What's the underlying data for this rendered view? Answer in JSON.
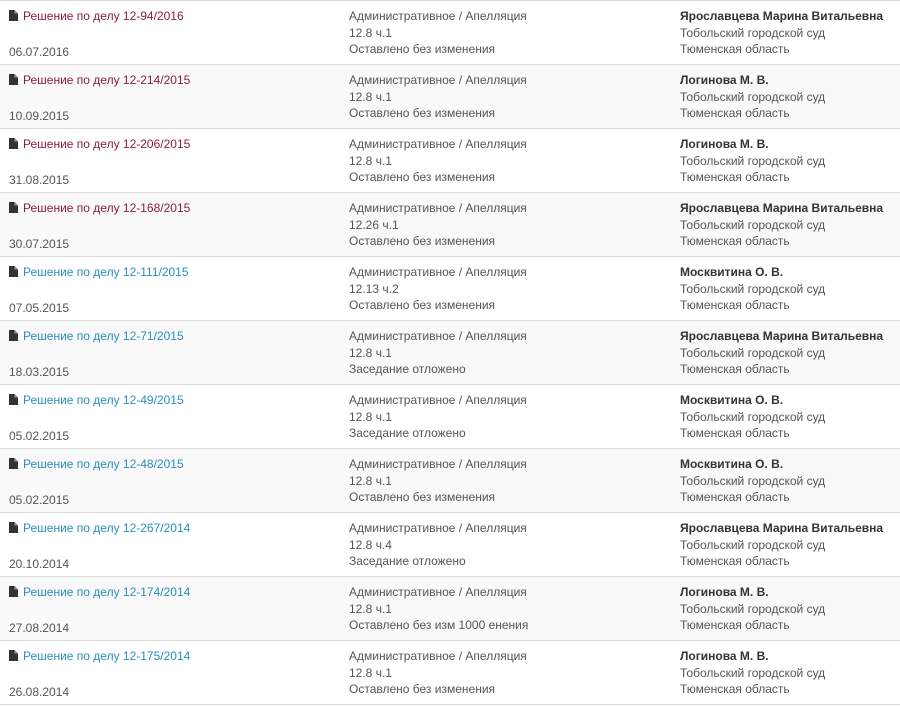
{
  "colors": {
    "visited_link": "#8b1a4a",
    "link": "#2a8dc0",
    "row_stripe": "#f9f9f9",
    "border": "#dddddd"
  },
  "icon": "document-icon",
  "rows": [
    {
      "title": "Решение по делу 12-94/2016",
      "date": "06.07.2016",
      "category": "Административное / Апелляция",
      "article": "12.8 ч.1",
      "result": "Оставлено без изменения",
      "judge": "Ярославцева Марина Витальевна",
      "court": "Тобольский городской суд",
      "region": "Тюменская область",
      "visited": true
    },
    {
      "title": "Решение по делу 12-214/2015",
      "date": "10.09.2015",
      "category": "Административное / Апелляция",
      "article": "12.8 ч.1",
      "result": "Оставлено без изменения",
      "judge": "Логинова М. В.",
      "court": "Тобольский городской суд",
      "region": "Тюменская область",
      "visited": true
    },
    {
      "title": "Решение по делу 12-206/2015",
      "date": "31.08.2015",
      "category": "Административное / Апелляция",
      "article": "12.8 ч.1",
      "result": "Оставлено без изменения",
      "judge": "Логинова М. В.",
      "court": "Тобольский городской суд",
      "region": "Тюменская область",
      "visited": true
    },
    {
      "title": "Решение по делу 12-168/2015",
      "date": "30.07.2015",
      "category": "Административное / Апелляция",
      "article": "12.26 ч.1",
      "result": "Оставлено без изменения",
      "judge": "Ярославцева Марина Витальевна",
      "court": "Тобольский городской суд",
      "region": "Тюменская область",
      "visited": true
    },
    {
      "title": "Решение по делу 12-111/2015",
      "date": "07.05.2015",
      "category": "Административное / Апелляция",
      "article": "12.13 ч.2",
      "result": "Оставлено без изменения",
      "judge": "Москвитина О. В.",
      "court": "Тобольский городской суд",
      "region": "Тюменская область",
      "visited": false
    },
    {
      "title": "Решение по делу 12-71/2015",
      "date": "18.03.2015",
      "category": "Административное / Апелляция",
      "article": "12.8 ч.1",
      "result": "Заседание отложено",
      "judge": "Ярославцева Марина Витальевна",
      "court": "Тобольский городской суд",
      "region": "Тюменская область",
      "visited": false
    },
    {
      "title": "Решение по делу 12-49/2015",
      "date": "05.02.2015",
      "category": "Административное / Апелляция",
      "article": "12.8 ч.1",
      "result": "Заседание отложено",
      "judge": "Москвитина О. В.",
      "court": "Тобольский городской суд",
      "region": "Тюменская область",
      "visited": false
    },
    {
      "title": "Решение по делу 12-48/2015",
      "date": "05.02.2015",
      "category": "Административное / Апелляция",
      "article": "12.8 ч.1",
      "result": "Оставлено без изменения",
      "judge": "Москвитина О. В.",
      "court": "Тобольский городской суд",
      "region": "Тюменская область",
      "visited": false
    },
    {
      "title": "Решение по делу 12-267/2014",
      "date": "20.10.2014",
      "category": "Административное / Апелляция",
      "article": "12.8 ч.4",
      "result": "Заседание отложено",
      "judge": "Ярославцева Марина Витальевна",
      "court": "Тобольский городской суд",
      "region": "Тюменская область",
      "visited": false
    },
    {
      "title": "Решение по делу 12-174/2014",
      "date": "27.08.2014",
      "category": "Административное / Апелляция",
      "article": "12.8 ч.1",
      "result": "Оставлено без изм 1000 енения",
      "judge": "Логинова М. В.",
      "court": "Тобольский городской суд",
      "region": "Тюменская область",
      "visited": false
    },
    {
      "title": "Решение по делу 12-175/2014",
      "date": "26.08.2014",
      "category": "Административное / Апелляция",
      "article": "12.8 ч.1",
      "result": "Оставлено без изменения",
      "judge": "Логинова М. В.",
      "court": "Тобольский городской суд",
      "region": "Тюменская область",
      "visited": false
    }
  ]
}
